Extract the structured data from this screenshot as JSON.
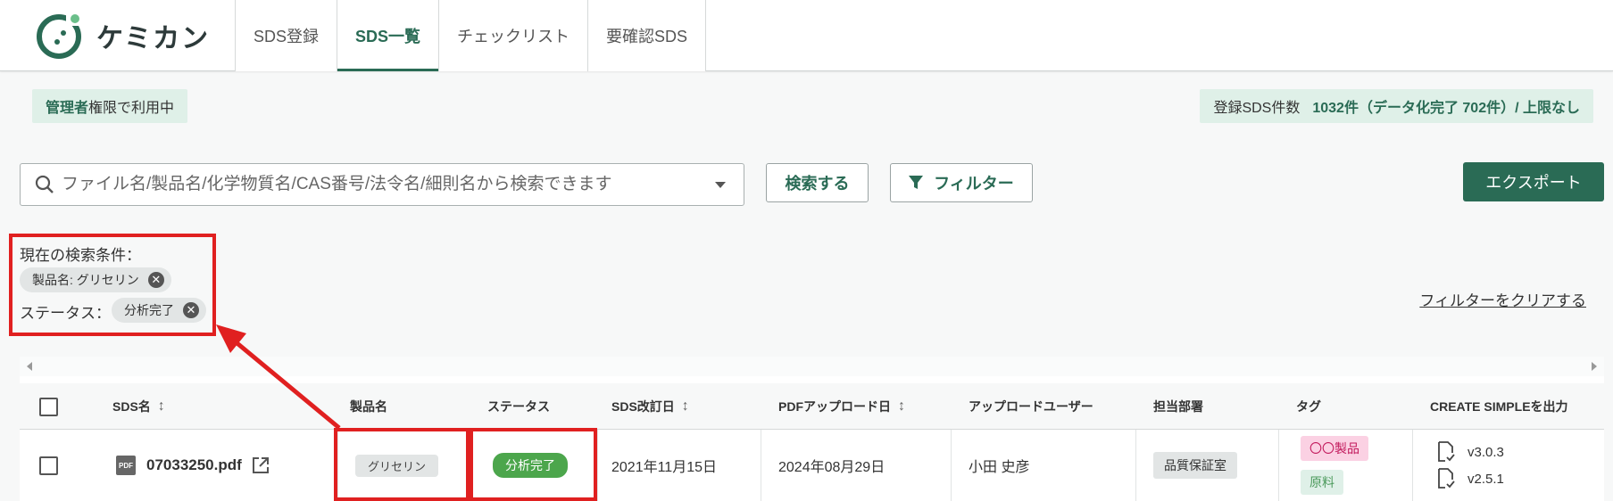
{
  "app": {
    "name": "ケミカン"
  },
  "nav": {
    "tabs": [
      {
        "label": "SDS登録"
      },
      {
        "label": "SDS一覧"
      },
      {
        "label": "チェックリスト"
      },
      {
        "label": "要確認SDS"
      }
    ]
  },
  "role": {
    "strong": "管理者",
    "rest": "権限で利用中"
  },
  "count": {
    "label": "登録SDS件数",
    "value": "1032件（データ化完了 702件）/ 上限なし"
  },
  "search": {
    "placeholder": "ファイル名/製品名/化学物質名/CAS番号/法令名/細則名から検索できます",
    "value": ""
  },
  "buttons": {
    "search": "検索する",
    "filter": "フィルター",
    "export": "エクスポート"
  },
  "conditions": {
    "title": "現在の検索条件：",
    "chip1": "製品名: グリセリン",
    "status_label": "ステータス：",
    "chip2": "分析完了",
    "clear": "フィルターをクリアする"
  },
  "table": {
    "headers": {
      "sds_name": "SDS名",
      "product": "製品名",
      "status": "ステータス",
      "revision": "SDS改訂日",
      "upload_date": "PDFアップロード日",
      "user": "アップロードユーザー",
      "dept": "担当部署",
      "tags": "タグ",
      "create_simple": "CREATE SIMPLEを出力"
    },
    "row": {
      "file_name": "07033250.pdf",
      "product": "グリセリン",
      "status": "分析完了",
      "revision": "2021年11月15日",
      "upload_date": "2024年08月29日",
      "user": "小田 史彦",
      "dept": "品質保証室",
      "tag1": "〇〇製品",
      "tag2": "原料",
      "version1": "v3.0.3",
      "version2": "v2.5.1"
    }
  },
  "colors": {
    "brand": "#2a6b55",
    "annotation": "#e02020",
    "status_green": "#4ca64c",
    "tag_pink": "#fbd1e3"
  }
}
